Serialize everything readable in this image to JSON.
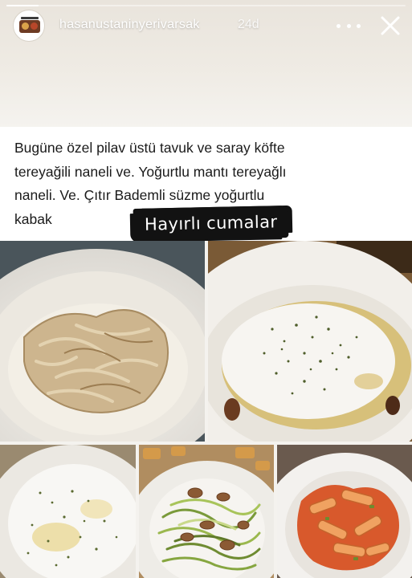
{
  "story": {
    "username": "hasanustaninyerivarsak",
    "time_ago": "24d",
    "progress": 0.08
  },
  "icons": {
    "more": "more-horizontal-icon",
    "close": "close-icon"
  },
  "caption": {
    "text": "Bugüne özel pilav üstü tavuk ve saray köfte\ntereyağili naneli ve. Yoğurtlu mantı tereyağlı\nnaneli.   Ve. Çıtır Bademli süzme yoğurtlu\nkabak",
    "sticker": "Hayırlı cumalar"
  },
  "photos": [
    "chicken-rice-photo",
    "manti-yogurt-photo",
    "yogurt-mint-photo",
    "zucchini-almond-photo",
    "tomato-chicken-photo"
  ]
}
